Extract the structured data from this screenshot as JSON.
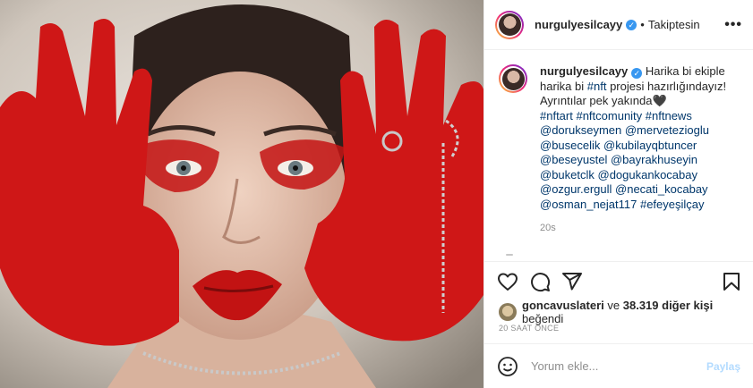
{
  "header": {
    "username": "nurgulyesilcayy",
    "separator": "•",
    "follow_status": "Takiptesin",
    "more": "•••"
  },
  "caption": {
    "username": "nurgulyesilcayy",
    "text": "Harika bi ekiple harika bi",
    "hashtag_inline": "#nft",
    "text2": "projesi hazırlığındayız! Ayrıntılar pek yakında🖤",
    "hashtags": "#nftart #nftcomunity #nftnews",
    "mentions": [
      "@dorukseymen @mervetezioglu",
      "@busecelik @kubilayqbtuncer",
      "@beseyustel @bayrakhuseyin",
      "@buketclk @dogukankocabay",
      "@ozgur.ergull @necati_kocabay",
      "@osman_nejat117 #efeyeşilçay"
    ],
    "time": "20s"
  },
  "likes": {
    "user": "goncavuslateri",
    "connector": "ve",
    "count": "38.319 diğer kişi",
    "suffix": "beğendi"
  },
  "posted_ago": "20 SAAT ÖNCE",
  "comment": {
    "placeholder": "Yorum ekle...",
    "post_label": "Paylaş"
  },
  "icons": {
    "like": "heart-icon",
    "comment": "comment-icon",
    "share": "share-icon",
    "save": "bookmark-icon",
    "emoji": "emoji-icon",
    "verified": "verified-badge-icon"
  },
  "colors": {
    "link": "#00376b",
    "verified": "#3897f0",
    "paint": "#d51a1a",
    "muted": "#8e8e8e"
  }
}
